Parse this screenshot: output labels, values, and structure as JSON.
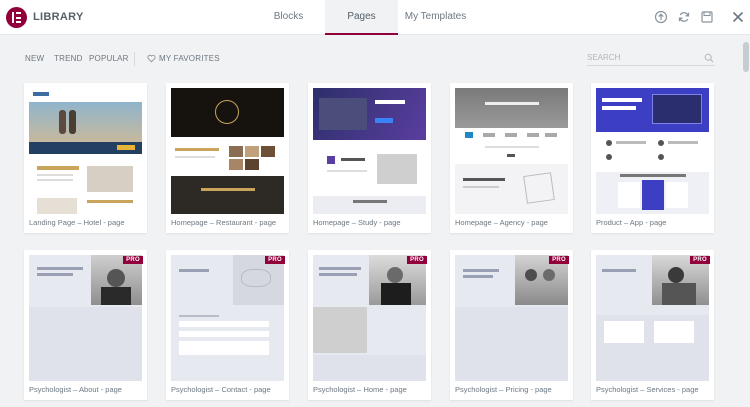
{
  "header": {
    "title": "LIBRARY",
    "tabs": [
      {
        "label": "Blocks",
        "active": false
      },
      {
        "label": "Pages",
        "active": true
      },
      {
        "label": "My Templates",
        "active": false
      }
    ],
    "icons": [
      "upload-icon",
      "sync-icon",
      "save-icon",
      "close-icon"
    ]
  },
  "filters": {
    "items": [
      "NEW",
      "TREND",
      "POPULAR"
    ],
    "favorites_label": "MY FAVORITES",
    "search_placeholder": "SEARCH"
  },
  "accent_color": "#92003b",
  "templates": [
    {
      "label": "Landing Page – Hotel - page",
      "pro": false
    },
    {
      "label": "Homepage – Restaurant - page",
      "pro": false
    },
    {
      "label": "Homepage – Study - page",
      "pro": false
    },
    {
      "label": "Homepage – Agency - page",
      "pro": false
    },
    {
      "label": "Product – App - page",
      "pro": false
    },
    {
      "label": "Psychologist – About - page",
      "pro": true
    },
    {
      "label": "Psychologist – Contact - page",
      "pro": true
    },
    {
      "label": "Psychologist – Home - page",
      "pro": true
    },
    {
      "label": "Psychologist – Pricing - page",
      "pro": true
    },
    {
      "label": "Psychologist – Services - page",
      "pro": true
    }
  ],
  "pro_badge": "PRO"
}
